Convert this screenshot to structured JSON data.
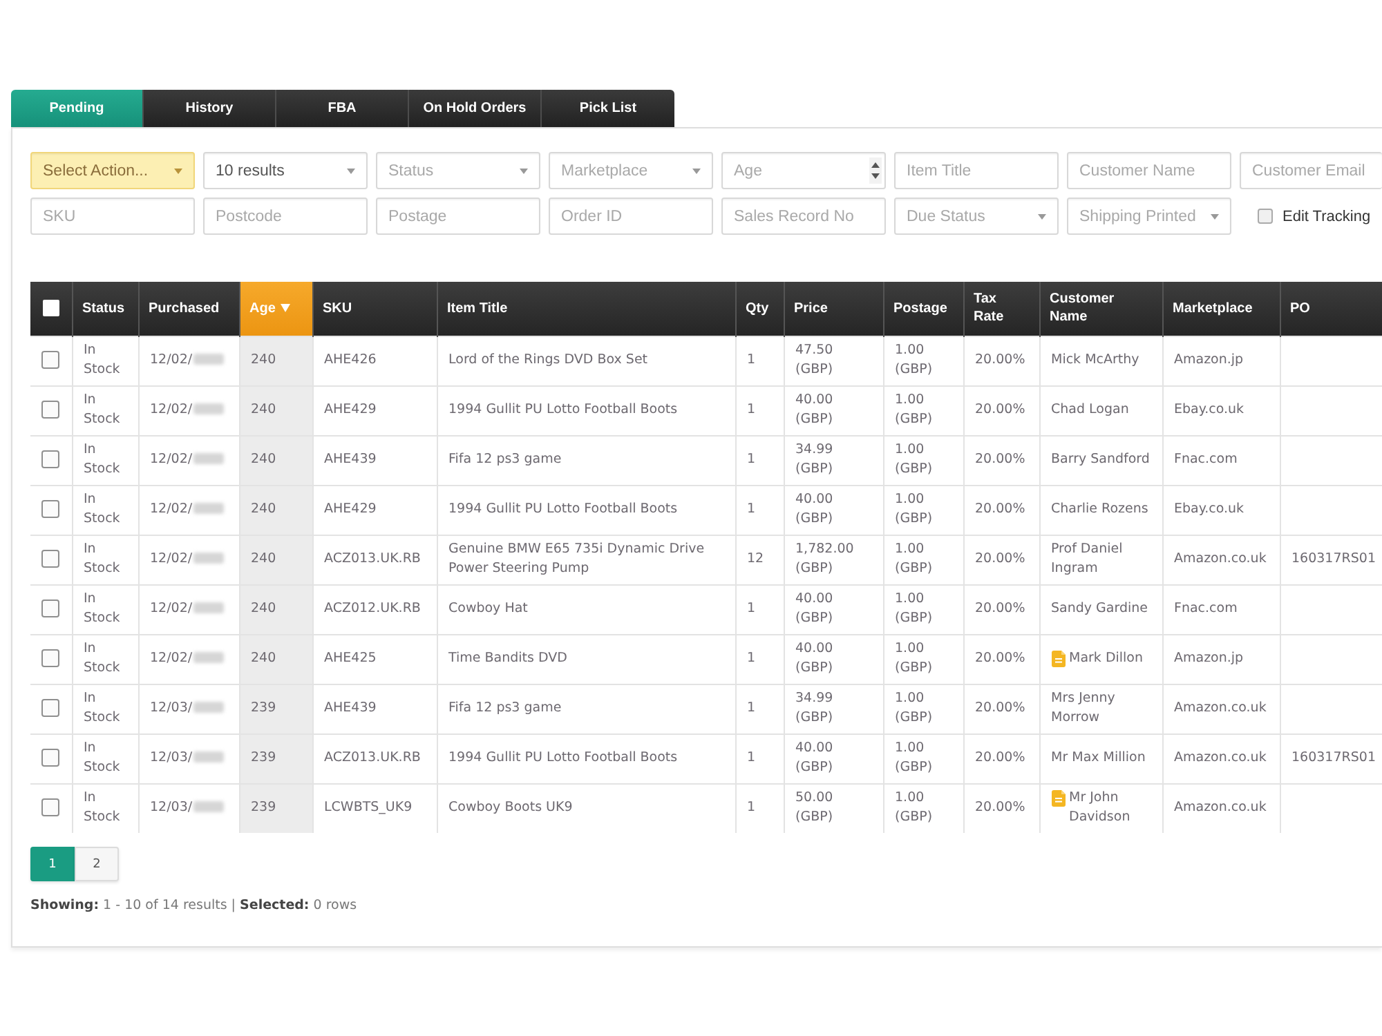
{
  "tabs": [
    {
      "label": "Pending",
      "selected": true
    },
    {
      "label": "History",
      "selected": false
    },
    {
      "label": "FBA",
      "selected": false
    },
    {
      "label": "On Hold Orders",
      "selected": false
    },
    {
      "label": "Pick List",
      "selected": false
    }
  ],
  "filter_rows": [
    {
      "fields": [
        {
          "kind": "action",
          "value": "Select Action..."
        },
        {
          "kind": "select",
          "value": "10 results"
        },
        {
          "kind": "select",
          "placeholder": "Status"
        },
        {
          "kind": "select",
          "placeholder": "Marketplace"
        },
        {
          "kind": "number",
          "placeholder": "Age"
        },
        {
          "kind": "text",
          "placeholder": "Item Title"
        },
        {
          "kind": "text",
          "placeholder": "Customer Name"
        },
        {
          "kind": "text",
          "placeholder": "Customer Email"
        }
      ]
    },
    {
      "fields": [
        {
          "kind": "text",
          "placeholder": "SKU"
        },
        {
          "kind": "text",
          "placeholder": "Postcode"
        },
        {
          "kind": "text",
          "placeholder": "Postage"
        },
        {
          "kind": "text",
          "placeholder": "Order ID"
        },
        {
          "kind": "text",
          "placeholder": "Sales Record No"
        },
        {
          "kind": "select",
          "placeholder": "Due Status"
        },
        {
          "kind": "select",
          "placeholder": "Shipping Printed"
        },
        {
          "kind": "checkbox",
          "label": "Edit Tracking",
          "checked": false
        }
      ]
    }
  ],
  "table": {
    "select_all": {
      "checked": false
    },
    "columns": [
      {
        "label": "Status",
        "sorted": false
      },
      {
        "label": "Purchased",
        "sorted": false
      },
      {
        "label": "Age",
        "sorted": true
      },
      {
        "label": "SKU",
        "sorted": false
      },
      {
        "label": "Item Title",
        "sorted": false
      },
      {
        "label": "Qty",
        "sorted": false
      },
      {
        "label": "Price",
        "sorted": false
      },
      {
        "label": "Postage",
        "sorted": false
      },
      {
        "label": "Tax Rate",
        "sorted": false
      },
      {
        "label": "Customer Name",
        "sorted": false
      },
      {
        "label": "Marketplace",
        "sorted": false
      },
      {
        "label": "PO",
        "sorted": false
      }
    ],
    "rows": [
      {
        "selected": false,
        "status": "In Stock",
        "purchased": "12/02/",
        "age": "240",
        "sku": "AHE426",
        "item_title": "Lord of the Rings DVD Box Set",
        "qty": "1",
        "price": "47.50 (GBP)",
        "postage": "1.00 (GBP)",
        "tax_rate": "20.00%",
        "customer_name": "Mick McArthy",
        "has_note": false,
        "marketplace": "Amazon.jp"
      },
      {
        "selected": false,
        "status": "In Stock",
        "purchased": "12/02/",
        "age": "240",
        "sku": "AHE429",
        "item_title": "1994 Gullit PU Lotto Football Boots",
        "qty": "1",
        "price": "40.00 (GBP)",
        "postage": "1.00 (GBP)",
        "tax_rate": "20.00%",
        "customer_name": "Chad Logan",
        "has_note": false,
        "marketplace": "Ebay.co.uk"
      },
      {
        "selected": false,
        "status": "In Stock",
        "purchased": "12/02/",
        "age": "240",
        "sku": "AHE439",
        "item_title": "Fifa 12 ps3 game",
        "qty": "1",
        "price": "34.99 (GBP)",
        "postage": "1.00 (GBP)",
        "tax_rate": "20.00%",
        "customer_name": "Barry Sandford",
        "has_note": false,
        "marketplace": "Fnac.com"
      },
      {
        "selected": false,
        "status": "In Stock",
        "purchased": "12/02/",
        "age": "240",
        "sku": "AHE429",
        "item_title": "1994 Gullit PU Lotto Football Boots",
        "qty": "1",
        "price": "40.00 (GBP)",
        "postage": "1.00 (GBP)",
        "tax_rate": "20.00%",
        "customer_name": "Charlie Rozens",
        "has_note": false,
        "marketplace": "Ebay.co.uk"
      },
      {
        "selected": false,
        "status": "In Stock",
        "purchased": "12/02/",
        "age": "240",
        "sku": "ACZ013.UK.RB",
        "item_title": "Genuine BMW E65 735i Dynamic Drive Power Steering Pump",
        "qty": "12",
        "price": "1,782.00 (GBP)",
        "postage": "1.00 (GBP)",
        "tax_rate": "20.00%",
        "customer_name": "Prof Daniel Ingram",
        "has_note": false,
        "marketplace": "Amazon.co.uk",
        "po": "160317RS01"
      },
      {
        "selected": false,
        "status": "In Stock",
        "purchased": "12/02/",
        "age": "240",
        "sku": "ACZ012.UK.RB",
        "item_title": "Cowboy Hat",
        "qty": "1",
        "price": "40.00 (GBP)",
        "postage": "1.00 (GBP)",
        "tax_rate": "20.00%",
        "customer_name": "Sandy Gardine",
        "has_note": false,
        "marketplace": "Fnac.com"
      },
      {
        "selected": false,
        "status": "In Stock",
        "purchased": "12/02/",
        "age": "240",
        "sku": "AHE425",
        "item_title": "Time Bandits DVD",
        "qty": "1",
        "price": "40.00 (GBP)",
        "postage": "1.00 (GBP)",
        "tax_rate": "20.00%",
        "customer_name": "Mark Dillon",
        "has_note": true,
        "marketplace": "Amazon.jp"
      },
      {
        "selected": false,
        "status": "In Stock",
        "purchased": "12/03/",
        "age": "239",
        "sku": "AHE439",
        "item_title": "Fifa 12 ps3 game",
        "qty": "1",
        "price": "34.99 (GBP)",
        "postage": "1.00 (GBP)",
        "tax_rate": "20.00%",
        "customer_name": "Mrs Jenny Morrow",
        "has_note": false,
        "marketplace": "Amazon.co.uk"
      },
      {
        "selected": false,
        "status": "In Stock",
        "purchased": "12/03/",
        "age": "239",
        "sku": "ACZ013.UK.RB",
        "item_title": "1994 Gullit PU Lotto Football Boots",
        "qty": "1",
        "price": "40.00 (GBP)",
        "postage": "1.00 (GBP)",
        "tax_rate": "20.00%",
        "customer_name": "Mr Max Million",
        "has_note": false,
        "marketplace": "Amazon.co.uk",
        "po": "160317RS01"
      },
      {
        "selected": false,
        "status": "In Stock",
        "purchased": "12/03/",
        "age": "239",
        "sku": "LCWBTS_UK9",
        "item_title": "Cowboy Boots UK9",
        "qty": "1",
        "price": "50.00 (GBP)",
        "postage": "1.00 (GBP)",
        "tax_rate": "20.00%",
        "customer_name": "Mr John Davidson",
        "has_note": true,
        "marketplace": "Amazon.co.uk"
      }
    ]
  },
  "pagination": [
    {
      "label": "1",
      "selected": true
    },
    {
      "label": "2",
      "selected": false
    }
  ],
  "summary": "**Showing:** 1 - 10 of 14 results | **Selected:** 0 rows"
}
